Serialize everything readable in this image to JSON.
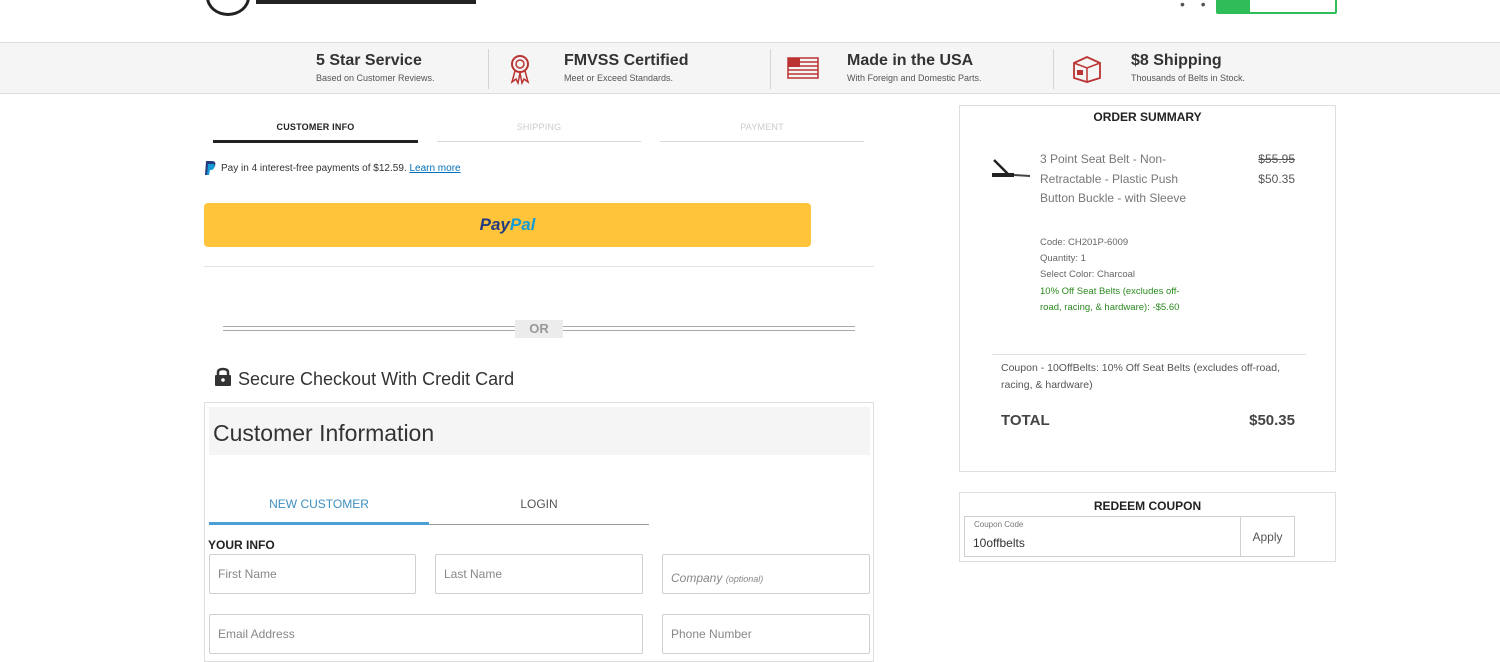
{
  "trust_bar": [
    {
      "title": "5 Star Service",
      "subtitle": "Based on Customer Reviews.",
      "icon": "star-service-icon"
    },
    {
      "title": "FMVSS Certified",
      "subtitle": "Meet or Exceed Standards.",
      "icon": "award-ribbon-icon"
    },
    {
      "title": "Made in the USA",
      "subtitle": "With Foreign and Domestic Parts.",
      "icon": "us-flag-icon"
    },
    {
      "title": "$8 Shipping",
      "subtitle": "Thousands of Belts in Stock.",
      "icon": "shipping-box-icon"
    }
  ],
  "steps": [
    {
      "label": "CUSTOMER INFO",
      "active": true
    },
    {
      "label": "SHIPPING",
      "active": false
    },
    {
      "label": "PAYMENT",
      "active": false
    }
  ],
  "paypal": {
    "installment_text": "Pay in 4 interest-free payments of $12.59.",
    "learn_more": "Learn more",
    "button_pay": "Pay",
    "button_pal": "Pal"
  },
  "separator": {
    "or": "OR"
  },
  "secure_checkout": {
    "title": "Secure Checkout With Credit Card"
  },
  "customer_info": {
    "title": "Customer Information",
    "tabs": [
      {
        "label": "NEW CUSTOMER",
        "active": true
      },
      {
        "label": "LOGIN",
        "active": false
      }
    ],
    "section_label": "YOUR INFO",
    "fields": {
      "first_name": "First Name",
      "last_name": "Last Name",
      "company": "Company",
      "company_optional": "(optional)",
      "email": "Email Address",
      "phone": "Phone Number"
    }
  },
  "order_summary": {
    "title": "ORDER SUMMARY",
    "item": {
      "name": "3 Point Seat Belt - Non-Retractable - Plastic Push Button Buckle - with Sleeve",
      "original_price": "$55.95",
      "price": "$50.35",
      "code": "Code: CH201P-6009",
      "quantity": "Quantity: 1",
      "color": "Select Color: Charcoal",
      "discount": "10% Off Seat Belts (excludes off-road, racing, & hardware): -$5.60"
    },
    "coupon_desc": "Coupon - 10OffBelts: 10% Off Seat Belts (excludes off-road, racing, & hardware)",
    "total_label": "TOTAL",
    "total_value": "$50.35"
  },
  "redeem_coupon": {
    "title": "REDEEM COUPON",
    "field_label": "Coupon Code",
    "value": "10offbelts",
    "apply_label": "Apply"
  },
  "colors": {
    "paypal_yellow": "#ffc439",
    "tab_blue": "#3d8fc1",
    "discount_green": "#2b8a1f",
    "account_green": "#2ebd59"
  }
}
